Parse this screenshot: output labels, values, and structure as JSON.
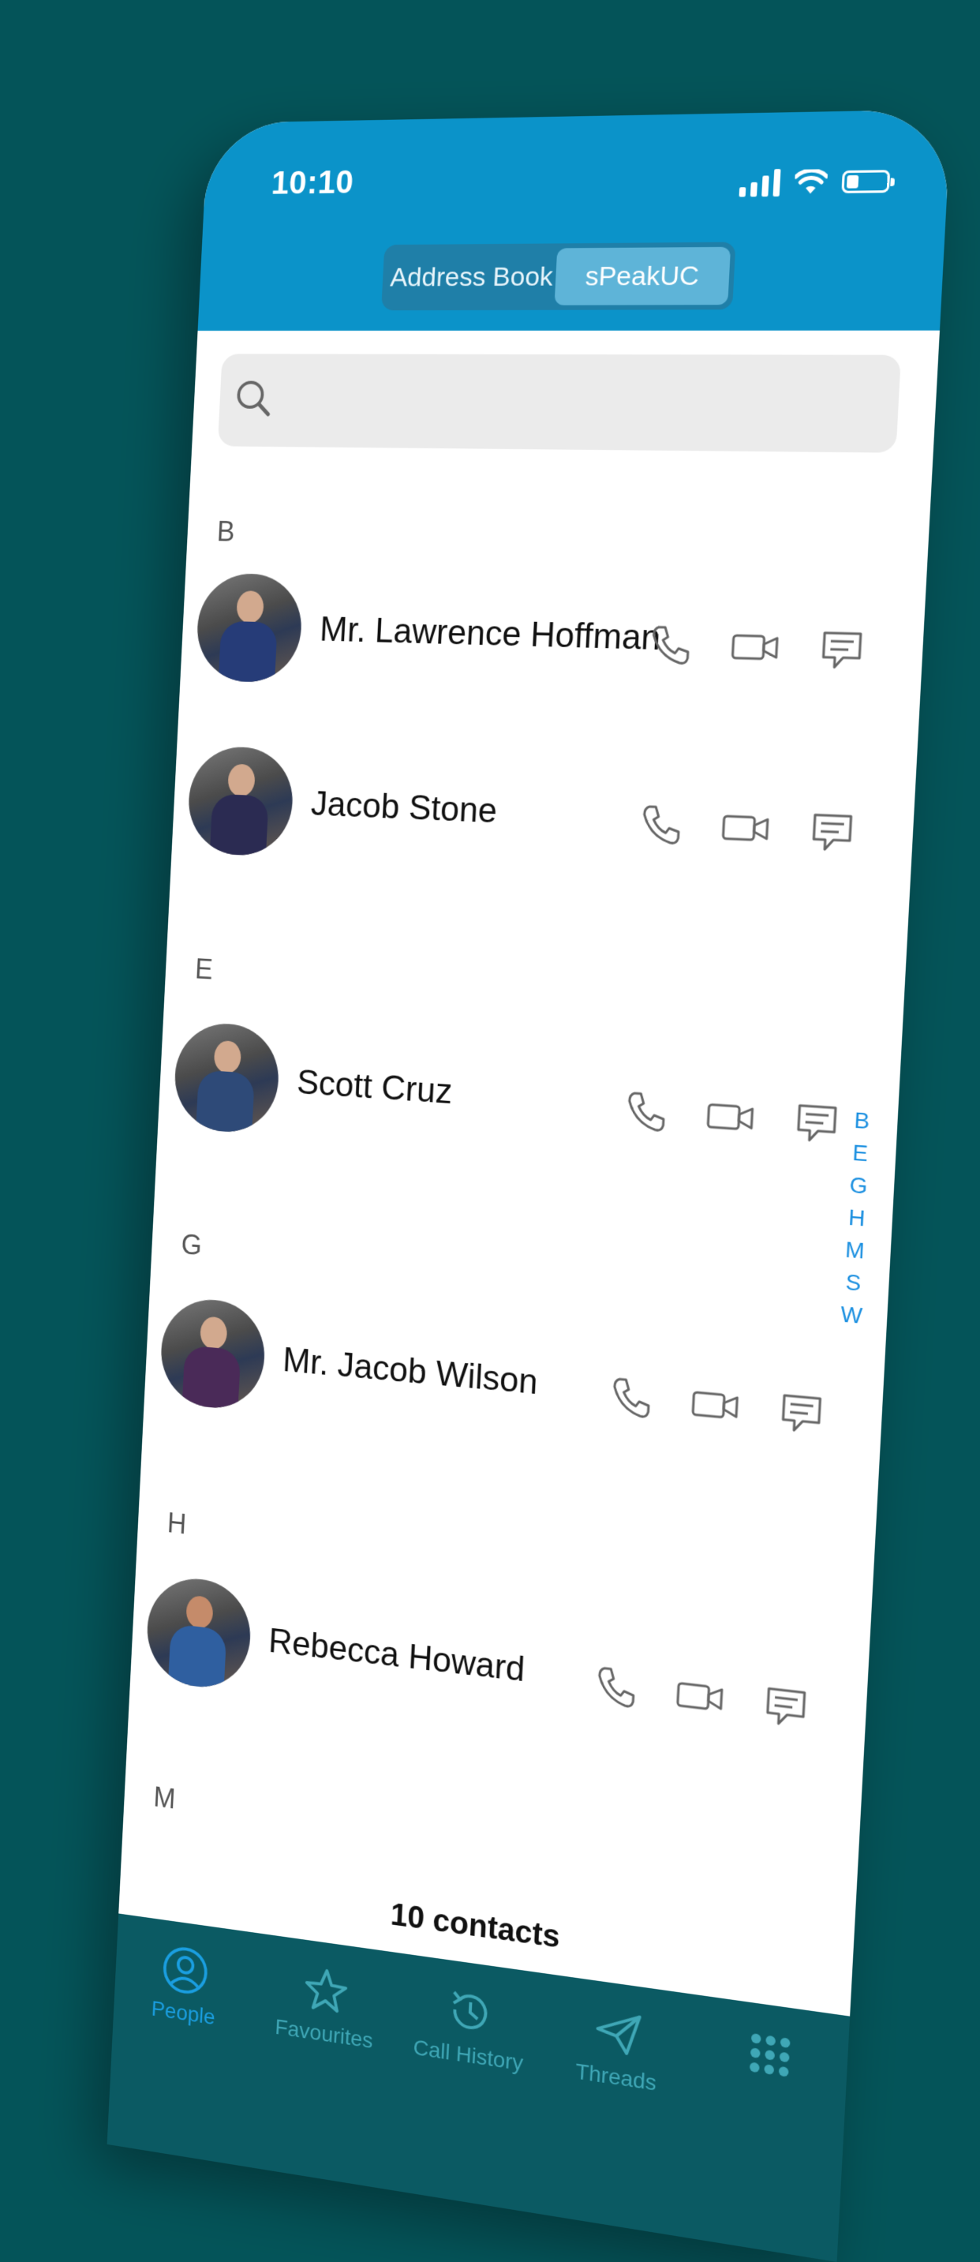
{
  "status": {
    "time": "10:10"
  },
  "header": {
    "tabs": [
      {
        "label": "Address Book",
        "active": false
      },
      {
        "label": "sPeakUC",
        "active": true
      }
    ]
  },
  "search": {
    "placeholder": ""
  },
  "contacts": {
    "sections": [
      {
        "letter": "B",
        "people": [
          "Mr. Lawrence Hoffman",
          "Jacob Stone"
        ]
      },
      {
        "letter": "E",
        "people": [
          "Scott Cruz"
        ]
      },
      {
        "letter": "G",
        "people": [
          "Mr. Jacob Wilson"
        ]
      },
      {
        "letter": "H",
        "people": [
          "Rebecca Howard"
        ]
      },
      {
        "letter": "M",
        "people": []
      }
    ],
    "count_label": "10 contacts"
  },
  "index_letters": [
    "B",
    "E",
    "G",
    "H",
    "M",
    "S",
    "W"
  ],
  "tabbar": {
    "items": [
      {
        "label": "People",
        "icon": "person-circle-icon",
        "active": true
      },
      {
        "label": "Favourites",
        "icon": "star-icon",
        "active": false
      },
      {
        "label": "Call History",
        "icon": "history-icon",
        "active": false
      },
      {
        "label": "Threads",
        "icon": "paper-plane-icon",
        "active": false
      },
      {
        "label": "",
        "icon": "grid-icon",
        "active": false
      }
    ]
  },
  "colors": {
    "background": "#045459",
    "header": "#0b93c9",
    "index_accent": "#1a8fe0"
  }
}
